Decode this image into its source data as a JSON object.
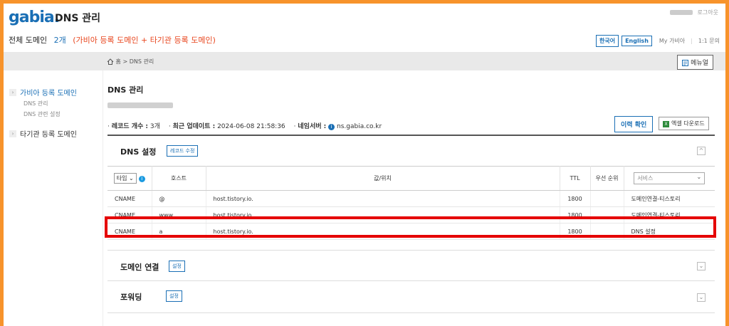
{
  "header": {
    "logo": "gabia.",
    "app_title": "DNS 관리",
    "logout": "로그아웃",
    "domain_label": "전체 도메인",
    "domain_count": "2개",
    "domain_desc": "(가비아 등록 도메인 + 타기관 등록 도메인)",
    "lang_ko": "한국어",
    "lang_en": "English",
    "my_gabia": "My 가비아",
    "separator": "|",
    "inquiry": "1:1 문의"
  },
  "breadcrumb": {
    "home": "홈 > DNS 관리"
  },
  "manual_button": "메뉴얼",
  "sidebar": {
    "gabia_domains": "가비아 등록 도메인",
    "sub_dns_manage": "DNS 관리",
    "sub_dns_settings": "DNS 관련 설정",
    "other_domains": "타기관 등록 도메인"
  },
  "content": {
    "title": "DNS 관리",
    "record_count_label": "레코드 개수 :",
    "record_count": "3개",
    "last_update_label": "최근 업데이트 :",
    "last_update": "2024-06-08 21:58:36",
    "nameserver_label": "네임서버 :",
    "nameserver": "ns.gabia.co.kr",
    "history_button": "이력 확인",
    "excel_button": "엑셀 다운로드"
  },
  "dns_panel": {
    "title": "DNS 설정",
    "edit_button": "레코드 수정",
    "toggle": "^",
    "columns": {
      "type": "타입",
      "host": "호스트",
      "value": "값/위치",
      "ttl": "TTL",
      "priority": "우선 순위",
      "service": "서비스"
    },
    "rows": [
      {
        "type": "CNAME",
        "host": "@",
        "value": "host.tistory.io.",
        "ttl": "1800",
        "priority": "",
        "service": "도메인연결-티스토리"
      },
      {
        "type": "CNAME",
        "host": "www",
        "value": "host.tistory.io.",
        "ttl": "1800",
        "priority": "",
        "service": "도메인연결-티스토리"
      },
      {
        "type": "CNAME",
        "host": "a",
        "value": "host.tistory.io.",
        "ttl": "1800",
        "priority": "",
        "service": "DNS 설정"
      }
    ]
  },
  "domain_link_panel": {
    "title": "도메인 연결",
    "button": "설정"
  },
  "forwarding_panel": {
    "title": "포워딩",
    "button": "설정"
  },
  "colors": {
    "accent": "#1a6fb5",
    "highlight": "#e50000",
    "frame": "#f7932b"
  },
  "icons": [
    "home-icon",
    "info-icon",
    "chevron-down-icon",
    "excel-icon",
    "manual-icon"
  ]
}
